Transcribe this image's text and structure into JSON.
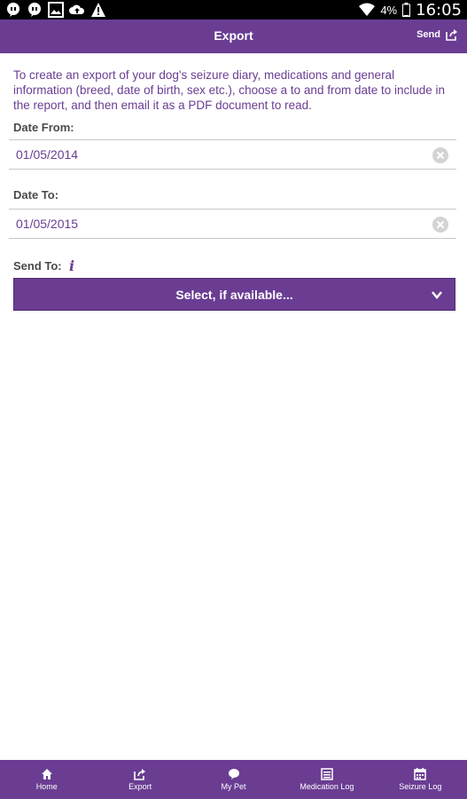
{
  "status_bar": {
    "battery": "4%",
    "time": "16:05"
  },
  "app_bar": {
    "title": "Export",
    "send_label": "Send"
  },
  "export_form": {
    "intro": "To create an export of your dog's seizure diary, medications and general information (breed, date of birth, sex etc.), choose a to and from date to include in the report, and then email it as a PDF document to read.",
    "date_from_label": "Date From:",
    "date_from_value": "01/05/2014",
    "date_to_label": "Date To:",
    "date_to_value": "01/05/2015",
    "send_to_label": "Send To:",
    "select_label": "Select, if available..."
  },
  "bottom_nav": {
    "items": [
      {
        "label": "Home",
        "icon": "home-icon"
      },
      {
        "label": "Export",
        "icon": "export-icon"
      },
      {
        "label": "My Pet",
        "icon": "pet-icon"
      },
      {
        "label": "Medication Log",
        "icon": "list-icon"
      },
      {
        "label": "Seizure Log",
        "icon": "calendar-icon"
      }
    ]
  },
  "colors": {
    "accent": "#6a3d93",
    "status_bar": "#000000",
    "background": "#ffffff"
  }
}
